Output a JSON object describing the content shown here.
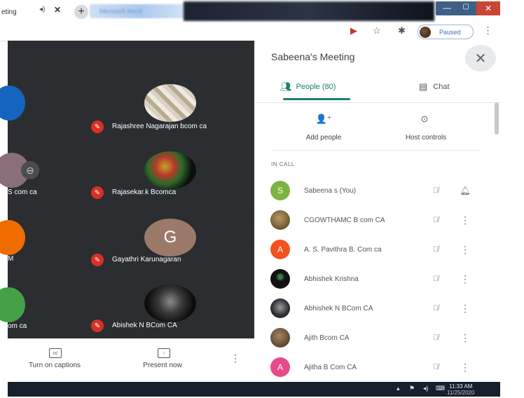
{
  "browser": {
    "tab_title": "eting",
    "blurred_tab_text": "Microsoft Word",
    "profile_status": "Paused"
  },
  "video_grid": {
    "tiles": [
      {
        "name": "Rajashree Nagarajan bcom ca",
        "avatar": "photo"
      },
      {
        "name": "Rajasekar.k Bcomca",
        "avatar": "photo"
      },
      {
        "name": "Gayathri Karunagaran",
        "avatar": "letter",
        "letter": "G",
        "color": "#9c7a6a"
      },
      {
        "name": "Abishek N BCom CA",
        "avatar": "photo"
      }
    ],
    "left_partial_labels": [
      "S com ca",
      "M",
      "om ca"
    ]
  },
  "bottom_bar": {
    "captions_label": "Turn on captions",
    "present_label": "Present now"
  },
  "panel": {
    "meeting_title": "Sabeena's Meeting",
    "tabs": {
      "people_label": "People (80)",
      "chat_label": "Chat"
    },
    "actions": {
      "add_people_label": "Add people",
      "host_controls_label": "Host controls"
    },
    "section_label": "IN CALL",
    "participants": [
      {
        "name": "Sabeena s (You)",
        "avatar": "letter",
        "letter": "S",
        "color": "#7cb342"
      },
      {
        "name": "CGOWTHAMC B com CA",
        "avatar": "photo",
        "color": "#6b5a3a"
      },
      {
        "name": "A. S. Pavithra B. Com ca",
        "avatar": "letter",
        "letter": "A",
        "color": "#f4511e"
      },
      {
        "name": "Abhishek Krishna",
        "avatar": "photo",
        "color": "#1f1f1f"
      },
      {
        "name": "Abhishek N BCom CA",
        "avatar": "photo",
        "color": "#2a2a30"
      },
      {
        "name": "Ajith Bcom CA",
        "avatar": "photo",
        "color": "#5a4a38"
      },
      {
        "name": "Ajitha B Com CA",
        "avatar": "letter",
        "letter": "A",
        "color": "#e84a8a"
      }
    ]
  },
  "taskbar": {
    "time": "11:33 AM",
    "date": "11/25/2020"
  },
  "colors": {
    "accent_blue": "#1a73e8",
    "mic_off_red": "#d93025",
    "meet_dark": "#2b2d30"
  }
}
